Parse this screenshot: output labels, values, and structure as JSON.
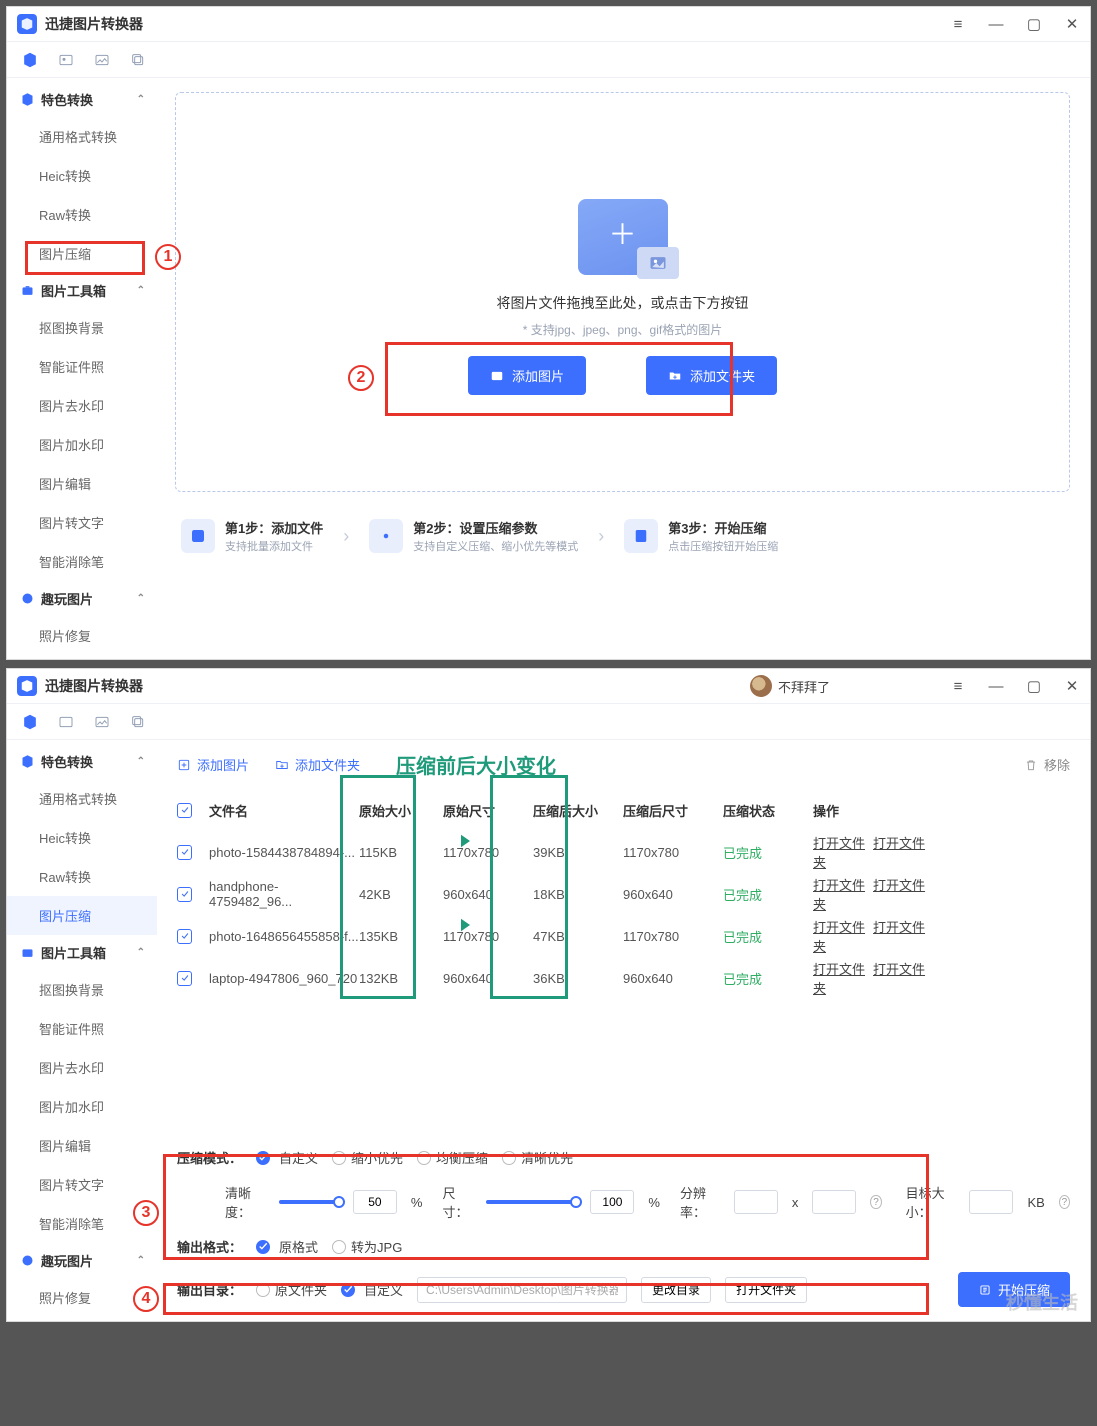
{
  "app": {
    "title": "迅捷图片转换器"
  },
  "sidebar": {
    "s1": {
      "label": "特色转换",
      "items": [
        "通用格式转换",
        "Heic转换",
        "Raw转换",
        "图片压缩"
      ]
    },
    "s2": {
      "label": "图片工具箱",
      "items": [
        "抠图换背景",
        "智能证件照",
        "图片去水印",
        "图片加水印",
        "图片编辑",
        "图片转文字",
        "智能消除笔"
      ]
    },
    "s3": {
      "label": "趣玩图片",
      "items": [
        "照片修复"
      ]
    }
  },
  "drop": {
    "headline": "将图片文件拖拽至此处，或点击下方按钮",
    "sub": "* 支持jpg、jpeg、png、gif格式的图片",
    "add_image": "添加图片",
    "add_folder": "添加文件夹"
  },
  "steps": {
    "s1t": "第1步：添加文件",
    "s1s": "支持批量添加文件",
    "s2t": "第2步：设置压缩参数",
    "s2s": "支持自定义压缩、缩小优先等模式",
    "s3t": "第3步：开始压缩",
    "s3s": "点击压缩按钮开始压缩"
  },
  "user_name": "不拜拜了",
  "toolbar2": {
    "add_image": "添加图片",
    "add_folder": "添加文件夹",
    "remove": "移除"
  },
  "annot": {
    "title": "压缩前后大小变化"
  },
  "table": {
    "headers": {
      "name": "文件名",
      "orig_size": "原始大小",
      "orig_dim": "原始尺寸",
      "comp_size": "压缩后大小",
      "comp_dim": "压缩后尺寸",
      "status": "压缩状态",
      "ops": "操作"
    },
    "rows": [
      {
        "name": "photo-1584438784894-...",
        "osize": "115KB",
        "odim": "1170x780",
        "csize": "39KB",
        "cdim": "1170x780",
        "status": "已完成"
      },
      {
        "name": "handphone-4759482_96...",
        "osize": "42KB",
        "odim": "960x640",
        "csize": "18KB",
        "cdim": "960x640",
        "status": "已完成"
      },
      {
        "name": "photo-1648656455858-f...",
        "osize": "135KB",
        "odim": "1170x780",
        "csize": "47KB",
        "cdim": "1170x780",
        "status": "已完成"
      },
      {
        "name": "laptop-4947806_960_720",
        "osize": "132KB",
        "odim": "960x640",
        "csize": "36KB",
        "cdim": "960x640",
        "status": "已完成"
      }
    ],
    "ops": {
      "open_file": "打开文件",
      "open_folder": "打开文件夹"
    }
  },
  "settings": {
    "mode_label": "压缩模式：",
    "modes": {
      "custom": "自定义",
      "shrink": "缩小优先",
      "balanced": "均衡压缩",
      "quality": "清晰优先"
    },
    "clarity_label": "清晰度：",
    "clarity_val": "50",
    "pct": "%",
    "size_label": "尺寸：",
    "size_val": "100",
    "res_label": "分辨率：",
    "x": "x",
    "target_label": "目标大小：",
    "kb": "KB",
    "outfmt_label": "输出格式：",
    "outfmt_orig": "原格式",
    "outfmt_jpg": "转为JPG",
    "outdir_label": "输出目录：",
    "outdir_orig": "原文件夹",
    "outdir_custom": "自定义",
    "path": "C:\\Users\\Admin\\Desktop\\图片转换器",
    "change_dir": "更改目录",
    "open_dir": "打开文件夹",
    "start": "开始压缩"
  },
  "watermark": "秒懂生活"
}
